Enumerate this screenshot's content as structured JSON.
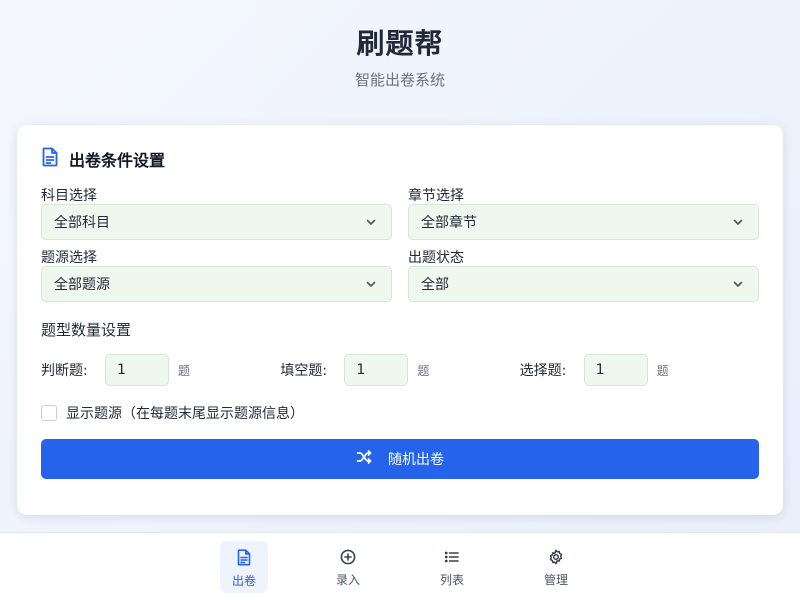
{
  "header": {
    "title": "刷题帮",
    "subtitle": "智能出卷系统"
  },
  "card": {
    "title": "出卷条件设置",
    "icon": "document-icon",
    "fields": [
      {
        "label": "科目选择",
        "value": "全部科目"
      },
      {
        "label": "章节选择",
        "value": "全部章节"
      },
      {
        "label": "题源选择",
        "value": "全部题源"
      },
      {
        "label": "出题状态",
        "value": "全部"
      }
    ],
    "quantity_section_label": "题型数量设置",
    "quantities": [
      {
        "label": "判断题:",
        "value": "1",
        "unit": "题"
      },
      {
        "label": "填空题:",
        "value": "1",
        "unit": "题"
      },
      {
        "label": "选择题:",
        "value": "1",
        "unit": "题"
      }
    ],
    "show_source": {
      "label": "显示题源（在每题末尾显示题源信息）",
      "checked": false
    },
    "generate_button": "随机出卷"
  },
  "bottom_nav": {
    "items": [
      {
        "label": "出卷",
        "icon": "document-icon",
        "active": true
      },
      {
        "label": "录入",
        "icon": "plus-circle-icon",
        "active": false
      },
      {
        "label": "列表",
        "icon": "list-icon",
        "active": false
      },
      {
        "label": "管理",
        "icon": "gear-icon",
        "active": false
      }
    ]
  },
  "colors": {
    "primary": "#2563eb",
    "input_bg": "#eff8ee",
    "active_nav_bg": "#eef3fd"
  }
}
